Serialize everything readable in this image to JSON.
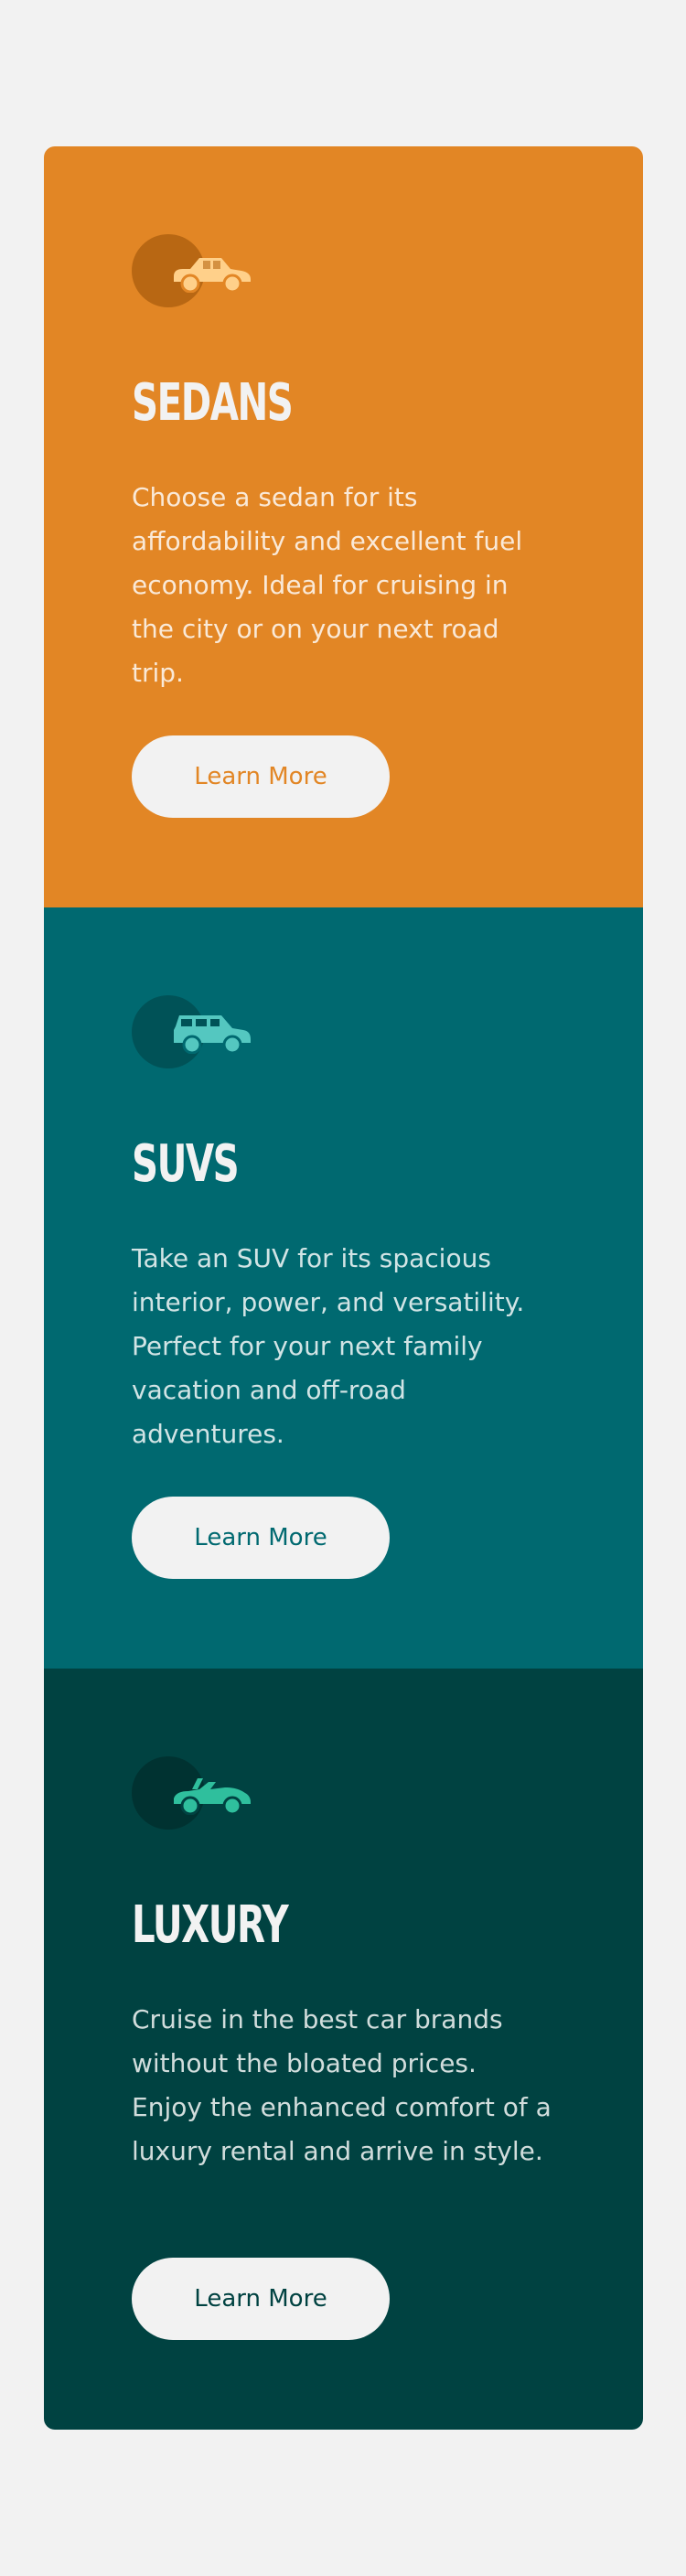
{
  "cards": [
    {
      "title": "Sedans",
      "description": "Choose a sedan for its affordability and excellent fuel economy. Ideal for cruising in the city or on your next road trip.",
      "button_label": "Learn More",
      "icon": "sedan-car-icon",
      "background_color": "#e28625",
      "accent_color": "#ffd08a"
    },
    {
      "title": "SUVs",
      "description": "Take an SUV for its spacious interior, power, and versatility. Perfect for your next family vacation and off-road adventures.",
      "button_label": "Learn More",
      "icon": "suv-car-icon",
      "background_color": "#006970",
      "accent_color": "#54c7c0"
    },
    {
      "title": "Luxury",
      "description": "Cruise in the best car brands without the bloated prices. Enjoy the enhanced comfort of a luxury rental and arrive in style.",
      "button_label": "Learn More",
      "icon": "luxury-car-icon",
      "background_color": "#004241",
      "accent_color": "#2fbf9d"
    }
  ],
  "page_background": "#f2f2f2"
}
